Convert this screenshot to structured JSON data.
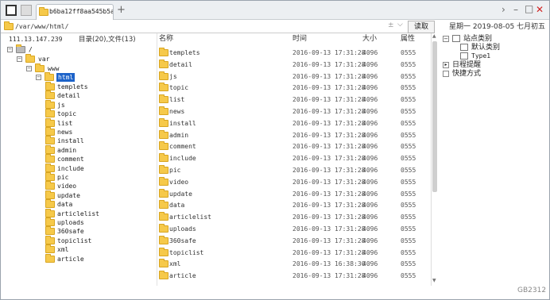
{
  "tab": {
    "title": "b6ba12ff8aa545b5a..."
  },
  "address": {
    "path": "/var/www/html/",
    "read_label": "读取"
  },
  "date_text": "星期一 2019-08-05 七月初五",
  "info": {
    "ip": "111.13.147.239",
    "counts": "目录(20),文件(13)"
  },
  "tree": {
    "root": "/",
    "var": "var",
    "www": "www",
    "html": "html",
    "children": [
      "templets",
      "detail",
      "js",
      "topic",
      "list",
      "news",
      "install",
      "admin",
      "comment",
      "include",
      "pic",
      "video",
      "update",
      "data",
      "articlelist",
      "uploads",
      "360safe",
      "topiclist",
      "xml",
      "article"
    ]
  },
  "headers": {
    "name": "名称",
    "time": "时间",
    "size": "大小",
    "attr": "属性"
  },
  "files": [
    {
      "name": "templets",
      "time": "2016-09-13 17:31:28",
      "size": "4096",
      "attr": "0555"
    },
    {
      "name": "detail",
      "time": "2016-09-13 17:31:28",
      "size": "4096",
      "attr": "0555"
    },
    {
      "name": "js",
      "time": "2016-09-13 17:31:28",
      "size": "4096",
      "attr": "0555"
    },
    {
      "name": "topic",
      "time": "2016-09-13 17:31:28",
      "size": "4096",
      "attr": "0555"
    },
    {
      "name": "list",
      "time": "2016-09-13 17:31:28",
      "size": "4096",
      "attr": "0555"
    },
    {
      "name": "news",
      "time": "2016-09-13 17:31:28",
      "size": "4096",
      "attr": "0555"
    },
    {
      "name": "install",
      "time": "2016-09-13 17:31:28",
      "size": "4096",
      "attr": "0555"
    },
    {
      "name": "admin",
      "time": "2016-09-13 17:31:28",
      "size": "4096",
      "attr": "0555"
    },
    {
      "name": "comment",
      "time": "2016-09-13 17:31:28",
      "size": "4096",
      "attr": "0555"
    },
    {
      "name": "include",
      "time": "2016-09-13 17:31:28",
      "size": "4096",
      "attr": "0555"
    },
    {
      "name": "pic",
      "time": "2016-09-13 17:31:28",
      "size": "4096",
      "attr": "0555"
    },
    {
      "name": "video",
      "time": "2016-09-13 17:31:28",
      "size": "4096",
      "attr": "0555"
    },
    {
      "name": "update",
      "time": "2016-09-13 17:31:28",
      "size": "4096",
      "attr": "0555"
    },
    {
      "name": "data",
      "time": "2016-09-13 17:31:28",
      "size": "4096",
      "attr": "0555"
    },
    {
      "name": "articlelist",
      "time": "2016-09-13 17:31:28",
      "size": "4096",
      "attr": "0555"
    },
    {
      "name": "uploads",
      "time": "2016-09-13 17:31:28",
      "size": "4096",
      "attr": "0555"
    },
    {
      "name": "360safe",
      "time": "2016-09-13 17:31:28",
      "size": "4096",
      "attr": "0555"
    },
    {
      "name": "topiclist",
      "time": "2016-09-13 17:31:28",
      "size": "4096",
      "attr": "0555"
    },
    {
      "name": "xml",
      "time": "2016-09-13 16:38:30",
      "size": "4096",
      "attr": "0555"
    },
    {
      "name": "article",
      "time": "2016-09-13 17:31:28",
      "size": "4096",
      "attr": "0555"
    }
  ],
  "side": {
    "site_category": "站点类别",
    "default_category": "默认类别",
    "type1": "Type1",
    "schedule": "日程提醒",
    "shortcut": "快捷方式"
  },
  "watermark": "GB2312",
  "colors": {
    "selection": "#1d63c9",
    "folder": "#f6c94a",
    "close": "#d02020"
  }
}
